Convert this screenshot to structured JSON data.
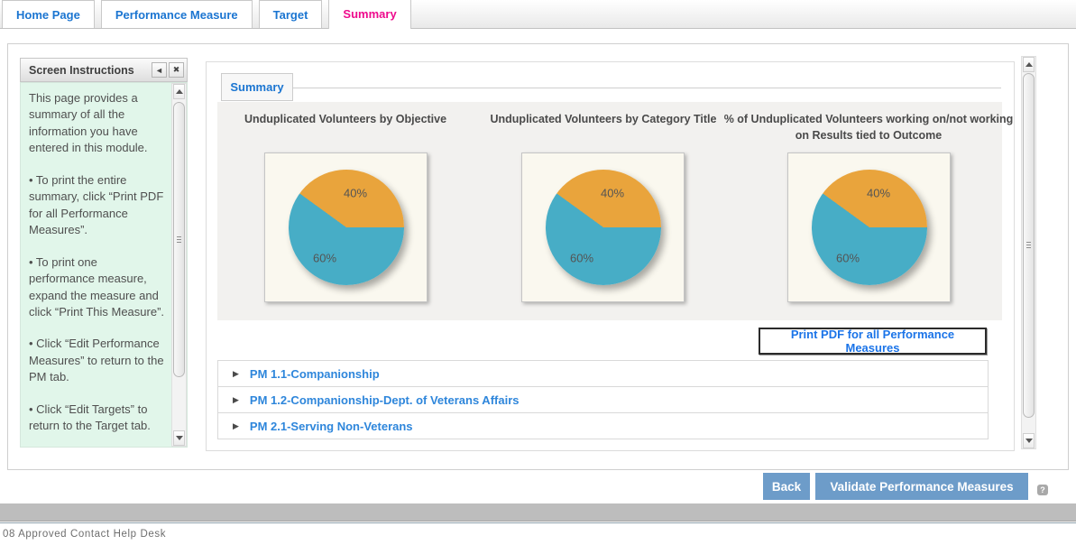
{
  "tabs": [
    {
      "label": "Home Page",
      "active": false
    },
    {
      "label": "Performance Measure",
      "active": false
    },
    {
      "label": "Target",
      "active": false
    },
    {
      "label": "Summary",
      "active": true
    }
  ],
  "sidebar": {
    "title": "Screen Instructions",
    "collapse_icon": "◄",
    "close_icon": "✖",
    "paragraphs": [
      "This page provides a summary of all the information you have entered in this module.",
      "• To print the entire summary, click “Print PDF for all Performance Measures”.",
      "• To print one performance measure, expand the measure and click “Print This Measure”.",
      "• Click “Edit Performance Measures” to return to the PM tab.",
      "• Click “Edit Targets” to return to the Target tab."
    ]
  },
  "main": {
    "inner_tab": "Summary",
    "expand_icon": "▶",
    "print_all_button": "Print PDF for all Performance Measures",
    "measures": [
      {
        "label": "PM 1.1-Companionship"
      },
      {
        "label": "PM 1.2-Companionship-Dept. of Veterans Affairs"
      },
      {
        "label": "PM 2.1-Serving Non-Veterans"
      }
    ]
  },
  "chart_data": [
    {
      "type": "pie",
      "title": "Unduplicated Volunteers by Objective",
      "labels": [
        "40%",
        "60%"
      ],
      "values": [
        40,
        60
      ],
      "colors": [
        "#e9a43c",
        "#47adc6"
      ],
      "legend_position": "none"
    },
    {
      "type": "pie",
      "title": "Unduplicated Volunteers by Category Title",
      "labels": [
        "40%",
        "60%"
      ],
      "values": [
        40,
        60
      ],
      "colors": [
        "#e9a43c",
        "#47adc6"
      ],
      "legend_position": "none"
    },
    {
      "type": "pie",
      "title": "% of Unduplicated Volunteers working on/not working on Results tied to Outcome",
      "labels": [
        "40%",
        "60%"
      ],
      "values": [
        40,
        60
      ],
      "colors": [
        "#e9a43c",
        "#47adc6"
      ],
      "legend_position": "none"
    }
  ],
  "actions": {
    "back": "Back",
    "validate": "Validate Performance Measures",
    "help_icon": "?"
  },
  "footer": {
    "text": "08 Approved Contact Help Desk"
  },
  "colors": {
    "tab_blue": "#1b75d1",
    "active_tab_pink": "#ee0b8d",
    "measure_link_blue": "#2e86db",
    "action_button_blue": "#6d9cc9",
    "pie_orange": "#e9a43c",
    "pie_teal": "#47adc6",
    "instructions_mint": "#e1f6ea"
  }
}
